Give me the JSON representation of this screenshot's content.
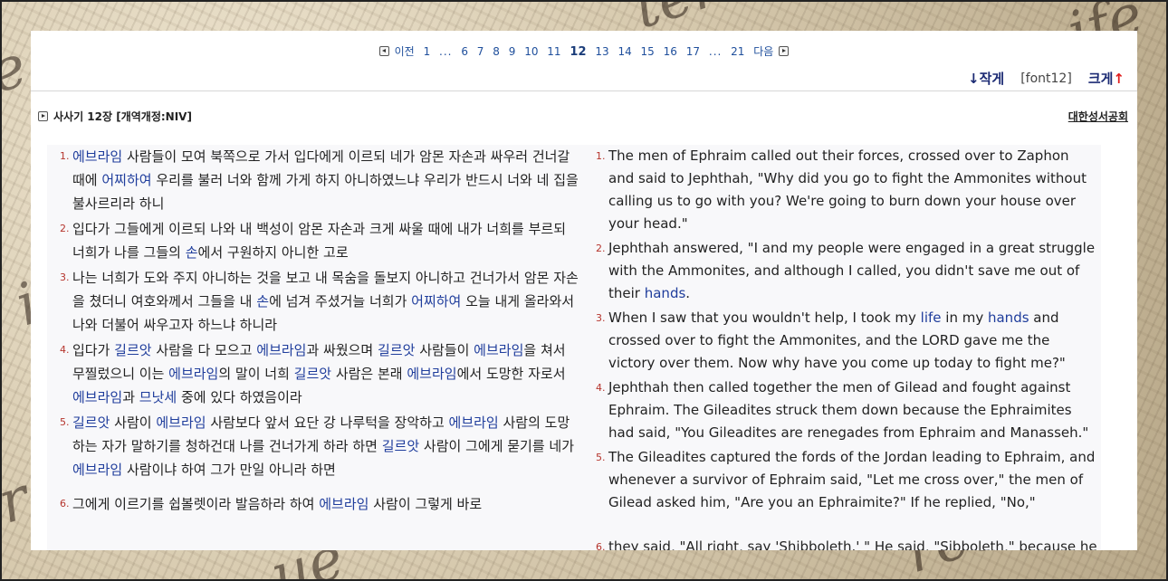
{
  "pagination": {
    "prev_label": "이전",
    "next_label": "다음",
    "pages_left": [
      "1"
    ],
    "dots": "...",
    "pages_mid": [
      "6",
      "7",
      "8",
      "9",
      "10",
      "11",
      "12",
      "13",
      "14",
      "15",
      "16",
      "17"
    ],
    "current": "12",
    "pages_right": [
      "21"
    ]
  },
  "font_controls": {
    "smaller_label": "작게",
    "smaller_arrow": "↓",
    "current": "[font12]",
    "larger_label": "크게",
    "larger_arrow": "↑"
  },
  "chapter": {
    "title": "사사기 12장 [개역개정:NIV]",
    "publisher": "대한성서공회"
  },
  "korean_verses": [
    {
      "num": "1.",
      "segments": [
        {
          "t": "에브라임",
          "h": true
        },
        {
          "t": " 사람들이 모여 북쪽으로 가서 입다에게 이르되 네가 암몬 자손과 싸우러 건너갈 때에 "
        },
        {
          "t": "어찌하여",
          "h": true
        },
        {
          "t": " 우리를 불러 너와 함께 가게 하지 아니하였느냐 우리가 반드시 너와 네 집을 불사르리라 하니"
        }
      ]
    },
    {
      "num": "2.",
      "segments": [
        {
          "t": "입다가 그들에게 이르되 나와 내 백성이 암몬 자손과 크게 싸울 때에 내가 너희를 부르되 너희가 나를 그들의 "
        },
        {
          "t": "손",
          "h": true
        },
        {
          "t": "에서 구원하지 아니한 고로"
        }
      ]
    },
    {
      "num": "3.",
      "segments": [
        {
          "t": "나는 너희가 도와 주지 아니하는 것을 보고 내 목숨을 돌보지 아니하고 건너가서 암몬 자손을 쳤더니 여호와께서 그들을 내 "
        },
        {
          "t": "손",
          "h": true
        },
        {
          "t": "에 넘겨 주셨거늘 너희가 "
        },
        {
          "t": "어찌하여",
          "h": true
        },
        {
          "t": " 오늘 내게 올라와서 나와 더불어 싸우고자 하느냐 하니라"
        }
      ]
    },
    {
      "num": "4.",
      "segments": [
        {
          "t": "입다가 "
        },
        {
          "t": "길르앗",
          "h": true
        },
        {
          "t": " 사람을 다 모으고 "
        },
        {
          "t": "에브라임",
          "h": true
        },
        {
          "t": "과 싸웠으며 "
        },
        {
          "t": "길르앗",
          "h": true
        },
        {
          "t": " 사람들이 "
        },
        {
          "t": "에브라임",
          "h": true
        },
        {
          "t": "을 쳐서 무찔렀으니 이는 "
        },
        {
          "t": "에브라임",
          "h": true
        },
        {
          "t": "의 말이 너희 "
        },
        {
          "t": "길르앗",
          "h": true
        },
        {
          "t": " 사람은 본래 "
        },
        {
          "t": "에브라임",
          "h": true
        },
        {
          "t": "에서 도망한 자로서 "
        },
        {
          "t": "에브라임",
          "h": true
        },
        {
          "t": "과 "
        },
        {
          "t": "므낫세",
          "h": true
        },
        {
          "t": " 중에 있다 하였음이라"
        }
      ]
    },
    {
      "num": "5.",
      "segments": [
        {
          "t": "길르앗",
          "h": true
        },
        {
          "t": " 사람이 "
        },
        {
          "t": "에브라임",
          "h": true
        },
        {
          "t": " 사람보다 앞서 요단 강 나루턱을 장악하고 "
        },
        {
          "t": "에브라임",
          "h": true
        },
        {
          "t": " 사람의 도망하는 자가 말하기를 청하건대 나를 건너가게 하라 하면 "
        },
        {
          "t": "길르앗",
          "h": true
        },
        {
          "t": " 사람이 그에게 묻기를 네가 "
        },
        {
          "t": "에브라임",
          "h": true
        },
        {
          "t": " 사람이냐 하여 그가 만일 아니라 하면"
        }
      ]
    },
    {
      "num": "6.",
      "segments": [
        {
          "t": "그에게 이르기를 쉽볼렛이라 발음하라 하여 "
        },
        {
          "t": "에브라임",
          "h": true
        },
        {
          "t": " 사람이 그렇게 바로"
        }
      ]
    }
  ],
  "english_verses": [
    {
      "num": "1.",
      "segments": [
        {
          "t": "The men of Ephraim called out their forces, crossed over to Zaphon and said to Jephthah, \"Why did you go to fight the Ammonites without calling us to go with you? We're going to burn down your house over your head.\""
        }
      ]
    },
    {
      "num": "2.",
      "segments": [
        {
          "t": "Jephthah answered, \"I and my people were engaged in a great struggle with the Ammonites, and although I called, you didn't save me out of their "
        },
        {
          "t": "hands",
          "h": true
        },
        {
          "t": "."
        }
      ]
    },
    {
      "num": "3.",
      "segments": [
        {
          "t": "When I saw that you wouldn't help, I took my "
        },
        {
          "t": "life",
          "h": true
        },
        {
          "t": " in my "
        },
        {
          "t": "hands",
          "h": true
        },
        {
          "t": " and crossed over to fight the Ammonites, and the LORD gave me the victory over them. Now why have you come up today to fight me?\""
        }
      ]
    },
    {
      "num": "4.",
      "segments": [
        {
          "t": "Jephthah then called together the men of Gilead and fought against Ephraim. The Gileadites struck them down because the Ephraimites had said, \"You Gileadites are renegades from Ephraim and Manasseh.\""
        }
      ]
    },
    {
      "num": "5.",
      "segments": [
        {
          "t": "The Gileadites captured the fords of the Jordan leading to Ephraim, and whenever a survivor of Ephraim said, \"Let me cross over,\" the men of Gilead asked him, \"Are you an Ephraimite?\" If he replied, \"No,\""
        }
      ]
    },
    {
      "num": "6.",
      "segments": [
        {
          "t": "they said, \"All right, say 'Shibboleth.' \" He said, \"Sibboleth,\" because he"
        }
      ]
    }
  ]
}
